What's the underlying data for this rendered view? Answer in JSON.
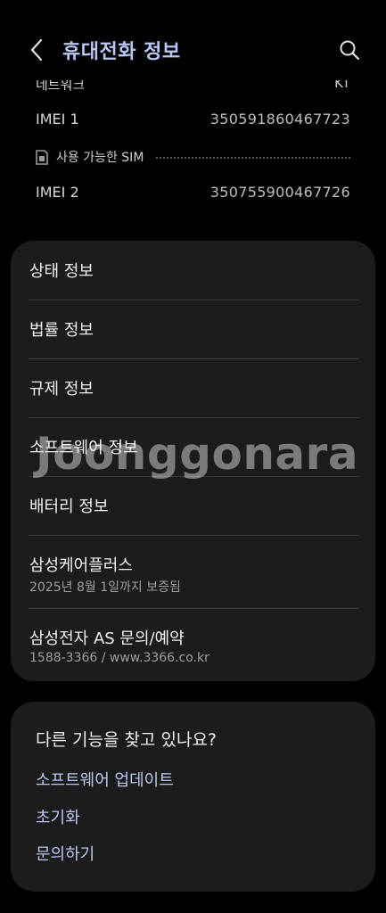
{
  "header": {
    "title": "휴대전화 정보"
  },
  "info": {
    "cut_label": "네트워크",
    "cut_value": "KT",
    "imei1_label": "IMEI 1",
    "imei1_value": "350591860467723",
    "sim_label": "사용 가능한 SIM",
    "imei2_label": "IMEI 2",
    "imei2_value": "350755900467726"
  },
  "menu": {
    "status": "상태 정보",
    "legal": "법률 정보",
    "regulatory": "규제 정보",
    "software": "소프트웨어 정보",
    "battery": "배터리 정보",
    "care_plus": "삼성케어플러스",
    "care_plus_sub": "2025년 8월 1일까지 보증됨",
    "as": "삼성전자 AS 문의/예약",
    "as_sub": "1588-3366 / www.3366.co.kr"
  },
  "suggest": {
    "title": "다른 기능을 찾고 있나요?",
    "link1": "소프트웨어 업데이트",
    "link2": "초기화",
    "link3": "문의하기"
  },
  "watermark": "Joonggonara",
  "colors": {
    "accent": "#b9c6f2",
    "card": "#1c1c1c",
    "background": "#000000"
  }
}
